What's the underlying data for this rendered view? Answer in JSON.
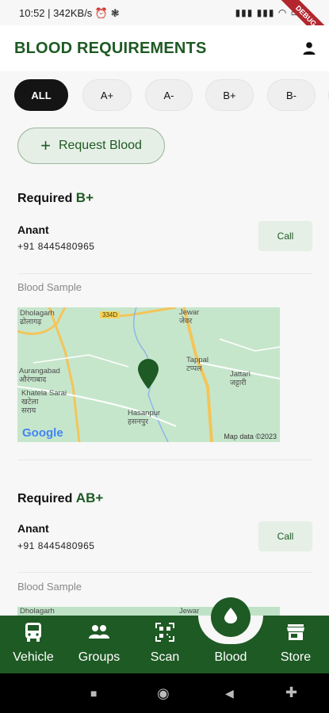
{
  "status_bar": {
    "time": "10:52",
    "speed": "342KB/s",
    "debug_label": "DEBUG"
  },
  "app_bar": {
    "title": "BLOOD REQUIREMENTS",
    "profile_icon": "person-icon"
  },
  "filters": {
    "chips": [
      "ALL",
      "A+",
      "A-",
      "B+",
      "B-"
    ],
    "selected": "ALL"
  },
  "request_button": {
    "label": "Request Blood",
    "icon": "plus-icon"
  },
  "requirements": [
    {
      "title_prefix": "Required",
      "blood_group": "B+",
      "donor_name": "Anant",
      "phone": "+91  8445480965",
      "call_label": "Call",
      "sample_label": "Blood Sample",
      "map": {
        "labels": {
          "dholagarh_en": "Dholagarh",
          "dholagarh_hi": "ढोलागढ़",
          "jewar_en": "Jewar",
          "jewar_hi": "जेवर",
          "road": "334D",
          "aurangabad_en": "Aurangabad",
          "aurangabad_hi": "औरंगाबाद",
          "khatela_en": "Khatela Sarai",
          "khatela_hi1": "खटेला",
          "khatela_hi2": "सराय",
          "tappal_en": "Tappal",
          "tappal_hi": "टप्पल",
          "jattari_en": "Jattari",
          "jattari_hi": "जट्टारी",
          "hasanpur_en": "Hasanpur",
          "hasanpur_hi": "हसनपुर"
        },
        "google": "Google",
        "copyright": "Map data ©2023"
      }
    },
    {
      "title_prefix": "Required",
      "blood_group": "AB+",
      "donor_name": "Anant",
      "phone": "+91  8445480965",
      "call_label": "Call",
      "sample_label": "Blood Sample",
      "map": {
        "labels": {
          "dholagarh_en": "Dholagarh",
          "jewar_en": "Jewar"
        }
      }
    }
  ],
  "bottom_nav": {
    "items": [
      "Vehicle",
      "Groups",
      "Scan",
      "Blood",
      "Store"
    ],
    "active": "Blood"
  },
  "colors": {
    "brand_green": "#1e5a24",
    "map_green": "#bfe2c6",
    "chip_active": "#141414"
  }
}
